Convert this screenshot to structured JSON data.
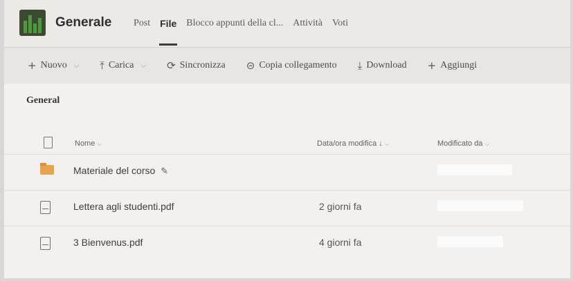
{
  "header": {
    "team_icon": "team-avatar",
    "title": "Generale",
    "tabs": [
      {
        "label": "Post"
      },
      {
        "label": "File",
        "active": true
      },
      {
        "label": "Blocco appunti della cl..."
      },
      {
        "label": "Attività"
      },
      {
        "label": "Voti"
      }
    ]
  },
  "toolbar": {
    "new_label": "Nuovo",
    "upload_label": "Carica",
    "sync_label": "Sincronizza",
    "copy_link_label": "Copia collegamento",
    "download_label": "Download",
    "add_label": "Aggiungi"
  },
  "library": {
    "breadcrumb": "General",
    "columns": {
      "name": "Nome",
      "modified": "Data/ora modifica",
      "modified_sort": "↓",
      "modified_by": "Modificato da"
    },
    "rows": [
      {
        "type": "folder",
        "name": "Materiale del corso",
        "modified": "",
        "modified_by": "redacted"
      },
      {
        "type": "pdf",
        "name": "Lettera agli studenti.pdf",
        "modified": "2 giorni fa",
        "modified_by": "redacted"
      },
      {
        "type": "pdf",
        "name": "3 Bienvenus.pdf",
        "modified": "4 giorni fa",
        "modified_by": "redacted"
      }
    ]
  },
  "colors": {
    "accent_folder": "#e8a34d",
    "team_avatar": "#3d4a33",
    "redaction": "#fbfbfb"
  }
}
